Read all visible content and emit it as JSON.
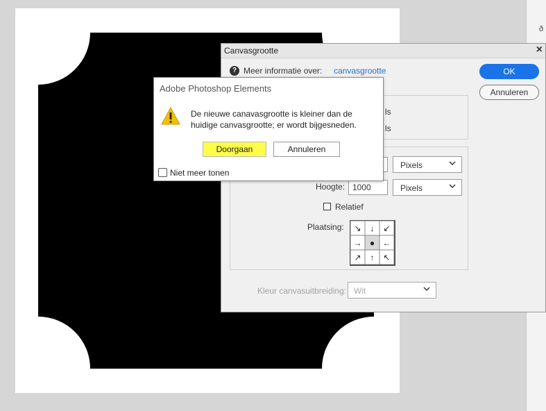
{
  "canvas_dialog": {
    "title": "Canvasgrootte",
    "close_glyph": "×",
    "info_label": "Meer informatie over:",
    "info_link": "canvasgrootte",
    "ok_label": "OK",
    "cancel_label": "Annuleren",
    "truncated_text_1": "ls",
    "truncated_text_2": "ls",
    "height_label": "Hoogte:",
    "height_value": "1000",
    "width_unit": "Pixels",
    "height_unit": "Pixels",
    "relative_label": "Relatief",
    "placement_label": "Plaatsing:",
    "anchor_arrows": [
      "↘",
      "↓",
      "↙",
      "→",
      "●",
      "←",
      "↗",
      "↑",
      "↖"
    ],
    "extension_color_label": "Kleur canvasuitbreiding:",
    "extension_color_value": "Wit"
  },
  "alert": {
    "title": "Adobe Photoshop Elements",
    "message": "De nieuwe canavasgrootte is kleiner dan de huidige canvasgrootte; er wordt bijgesneden.",
    "continue_label": "Doorgaan",
    "cancel_label": "Annuleren",
    "dont_show_label": "Niet meer tonen"
  },
  "icons": {
    "info": "info-icon",
    "warning": "warning-icon",
    "chevron": "chevron-down-icon",
    "close": "close-icon"
  },
  "colors": {
    "accent_blue": "#1a73e8",
    "highlight_yellow": "#fdfd4a",
    "warning_yellow": "#f2c200"
  }
}
